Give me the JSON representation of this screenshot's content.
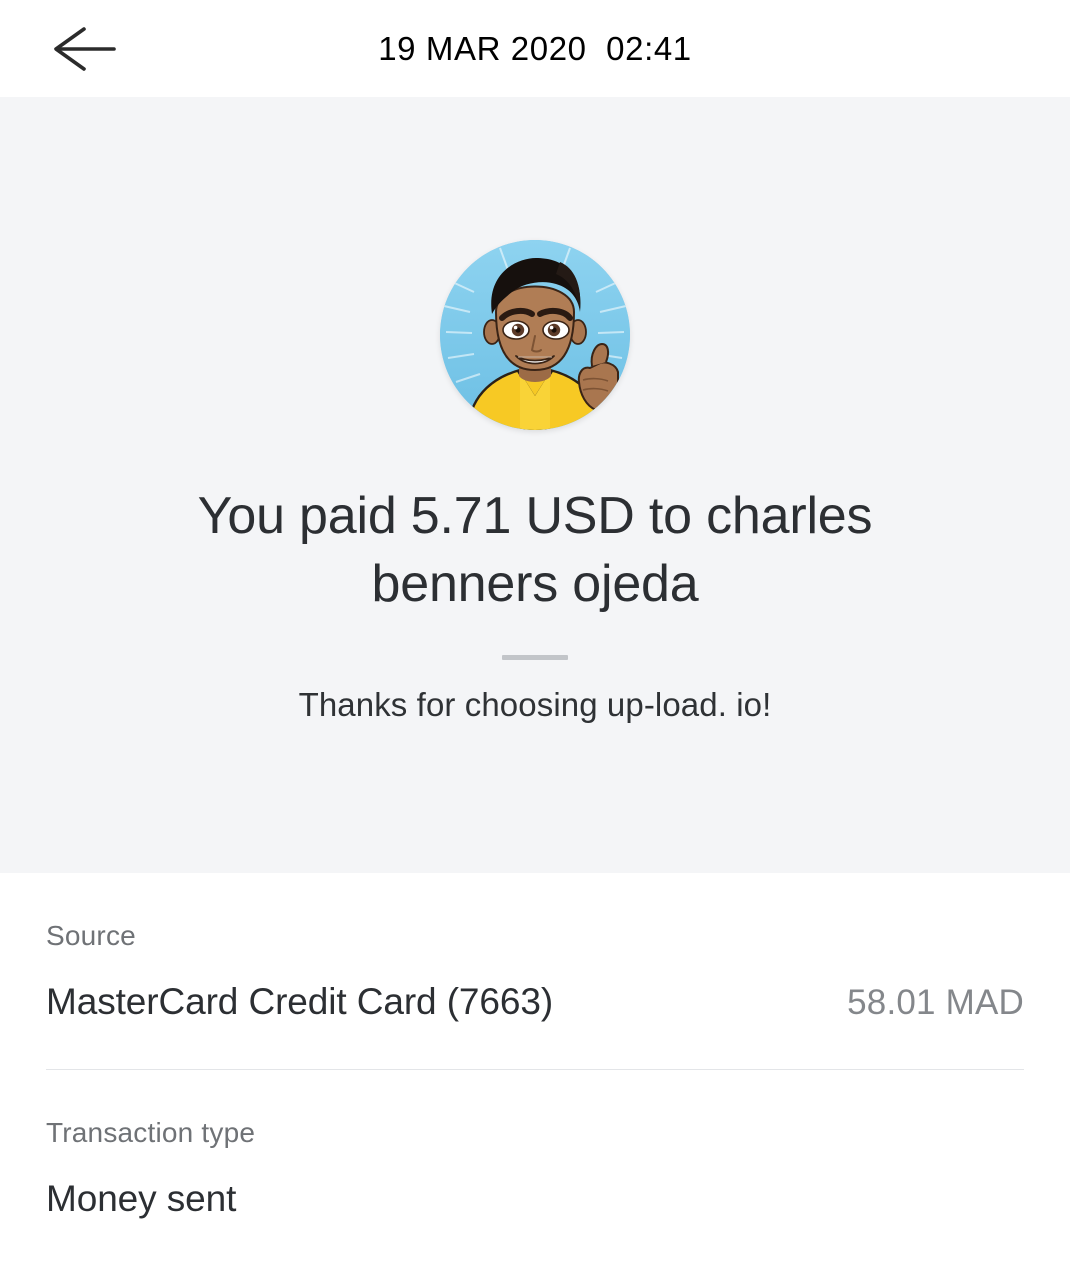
{
  "header": {
    "back_icon": "arrow-left-icon",
    "title": "19 MAR 2020  02:41"
  },
  "hero": {
    "avatar_alt": "user-avatar",
    "title": "You paid 5.71 USD to charles benners ojeda",
    "subtitle": "Thanks for choosing up-load. io!",
    "background_color": "#f4f5f7",
    "divider_color": "#c2c5c9"
  },
  "transaction": {
    "amount": "5.71",
    "currency": "USD",
    "recipient": "charles benners ojeda",
    "rows": [
      {
        "label": "Source",
        "value": "MasterCard Credit Card (7663)",
        "amount": "58.01 MAD"
      },
      {
        "label": "Transaction type",
        "value": "Money sent",
        "amount": ""
      }
    ]
  },
  "colors": {
    "text_primary": "#2c2f33",
    "text_secondary": "#6f7276",
    "amount_text": "#84878b",
    "page_background": "#ffffff",
    "avatar_shirt": "#f7c924",
    "avatar_sky": "#7cc7ea",
    "avatar_skin": "#a9764f",
    "avatar_hair": "#1c1512"
  }
}
